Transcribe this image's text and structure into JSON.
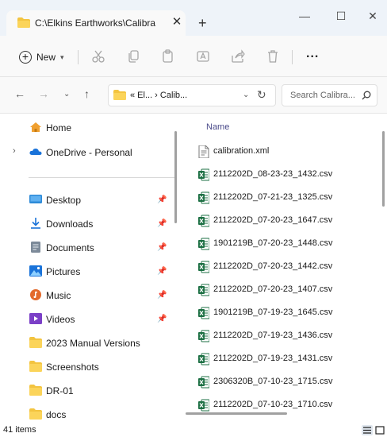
{
  "window": {
    "tab_title": "C:\\Elkins Earthworks\\Calibrati",
    "tab_close": "✕",
    "new_tab": "+",
    "minimize": "—",
    "maximize": "☐",
    "close": "✕"
  },
  "toolbar": {
    "new_label": "New",
    "more_label": "..."
  },
  "navigation": {
    "address_path": "« El...  ›  Calib...",
    "search_placeholder": "Search Calibra..."
  },
  "sidebar": {
    "items": [
      {
        "label": "Home",
        "icon": "home-icon",
        "pinned": false,
        "expandable": false
      },
      {
        "label": "OneDrive - Personal",
        "icon": "cloud-icon",
        "pinned": false,
        "expandable": true
      },
      {
        "label": "Desktop",
        "icon": "desktop-icon",
        "pinned": true,
        "expandable": false
      },
      {
        "label": "Downloads",
        "icon": "download-icon",
        "pinned": true,
        "expandable": false
      },
      {
        "label": "Documents",
        "icon": "documents-icon",
        "pinned": true,
        "expandable": false
      },
      {
        "label": "Pictures",
        "icon": "pictures-icon",
        "pinned": true,
        "expandable": false
      },
      {
        "label": "Music",
        "icon": "music-icon",
        "pinned": true,
        "expandable": false
      },
      {
        "label": "Videos",
        "icon": "videos-icon",
        "pinned": true,
        "expandable": false
      },
      {
        "label": "2023 Manual Versions",
        "icon": "folder-icon",
        "pinned": false,
        "expandable": false
      },
      {
        "label": "Screenshots",
        "icon": "folder-icon",
        "pinned": false,
        "expandable": false
      },
      {
        "label": "DR-01",
        "icon": "folder-icon",
        "pinned": false,
        "expandable": false
      },
      {
        "label": "docs",
        "icon": "folder-icon",
        "pinned": false,
        "expandable": false
      }
    ]
  },
  "file_list": {
    "column_header": "Name",
    "files": [
      {
        "name": "calibration.xml",
        "type": "xml"
      },
      {
        "name": "2112202D_08-23-23_1432.csv",
        "type": "csv"
      },
      {
        "name": "2112202D_07-21-23_1325.csv",
        "type": "csv"
      },
      {
        "name": "2112202D_07-20-23_1647.csv",
        "type": "csv"
      },
      {
        "name": "1901219B_07-20-23_1448.csv",
        "type": "csv"
      },
      {
        "name": "2112202D_07-20-23_1442.csv",
        "type": "csv"
      },
      {
        "name": "2112202D_07-20-23_1407.csv",
        "type": "csv"
      },
      {
        "name": "1901219B_07-19-23_1645.csv",
        "type": "csv"
      },
      {
        "name": "2112202D_07-19-23_1436.csv",
        "type": "csv"
      },
      {
        "name": "2112202D_07-19-23_1431.csv",
        "type": "csv"
      },
      {
        "name": "2306320B_07-10-23_1715.csv",
        "type": "csv"
      },
      {
        "name": "2112202D_07-10-23_1710.csv",
        "type": "csv"
      }
    ]
  },
  "status": {
    "item_count": "41 items"
  },
  "colors": {
    "folder_yellow": "#f3c440",
    "excel_green": "#1d7044",
    "accent_blue": "#0a64c8"
  }
}
